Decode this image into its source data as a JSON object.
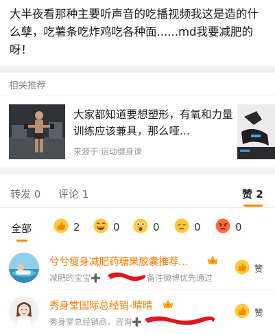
{
  "post": {
    "text": "大半夜看那种主要听声音的吃播视频我这是造的什么孽，吃薯条吃炸鸡吃各种面......md我要减肥的呀！"
  },
  "recommend": {
    "header": "相关推荐",
    "title": "大家都知道要想塑形，有氧和力量训练应该兼具，那么哑...",
    "source": "来源于 运动健身课"
  },
  "tabs": {
    "repost": "转发 0",
    "comment": "评论 1",
    "like": "赞 2"
  },
  "reactions": {
    "all": "全部",
    "items": [
      {
        "icon": "thumbs-up-emoji",
        "count": "2"
      },
      {
        "icon": "laughing-emoji",
        "count": "0"
      },
      {
        "icon": "surprised-emoji",
        "count": "0"
      },
      {
        "icon": "sad-emoji",
        "count": "0"
      },
      {
        "icon": "angry-emoji",
        "count": "0"
      }
    ]
  },
  "likers": [
    {
      "name": "兮兮瘦身减肥药糖果胶囊推荐...",
      "desc": "减肥的宝宝➕",
      "desc_tail": "备注微博优先通过",
      "like_label": "赞"
    },
    {
      "name": "秀身堂国际总经销-晴晴",
      "desc": "秀身堂总经销商，咨询➕",
      "desc_tail": "",
      "like_label": "赞"
    }
  ],
  "colors": {
    "accent": "#ff8200",
    "username": "#ff7a00",
    "muted": "#999999",
    "divider_band": "#f2f2f2"
  }
}
